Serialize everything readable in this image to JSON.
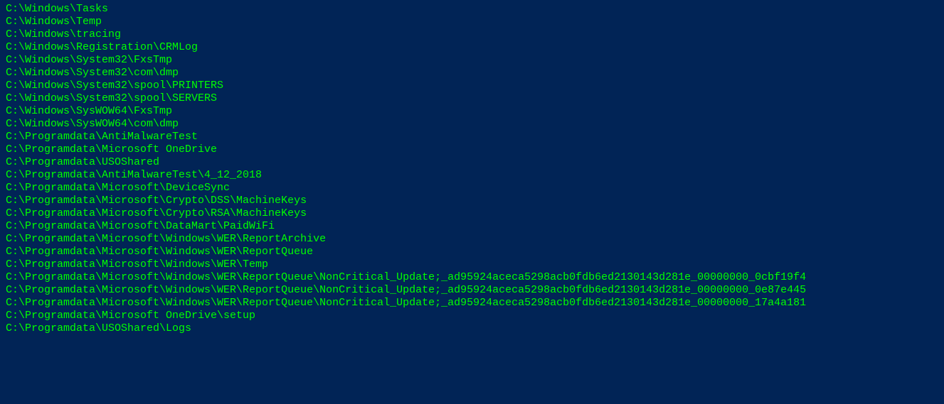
{
  "terminal": {
    "lines": [
      "C:\\Windows\\Tasks",
      "C:\\Windows\\Temp",
      "C:\\Windows\\tracing",
      "C:\\Windows\\Registration\\CRMLog",
      "C:\\Windows\\System32\\FxsTmp",
      "C:\\Windows\\System32\\com\\dmp",
      "C:\\Windows\\System32\\spool\\PRINTERS",
      "C:\\Windows\\System32\\spool\\SERVERS",
      "C:\\Windows\\SysWOW64\\FxsTmp",
      "C:\\Windows\\SysWOW64\\com\\dmp",
      "C:\\Programdata\\AntiMalwareTest",
      "C:\\Programdata\\Microsoft OneDrive",
      "C:\\Programdata\\USOShared",
      "C:\\Programdata\\AntiMalwareTest\\4_12_2018",
      "C:\\Programdata\\Microsoft\\DeviceSync",
      "C:\\Programdata\\Microsoft\\Crypto\\DSS\\MachineKeys",
      "C:\\Programdata\\Microsoft\\Crypto\\RSA\\MachineKeys",
      "C:\\Programdata\\Microsoft\\DataMart\\PaidWiFi",
      "C:\\Programdata\\Microsoft\\Windows\\WER\\ReportArchive",
      "C:\\Programdata\\Microsoft\\Windows\\WER\\ReportQueue",
      "C:\\Programdata\\Microsoft\\Windows\\WER\\Temp",
      "C:\\Programdata\\Microsoft\\Windows\\WER\\ReportQueue\\NonCritical_Update;_ad95924aceca5298acb0fdb6ed2130143d281e_00000000_0cbf19f4",
      "C:\\Programdata\\Microsoft\\Windows\\WER\\ReportQueue\\NonCritical_Update;_ad95924aceca5298acb0fdb6ed2130143d281e_00000000_0e87e445",
      "C:\\Programdata\\Microsoft\\Windows\\WER\\ReportQueue\\NonCritical_Update;_ad95924aceca5298acb0fdb6ed2130143d281e_00000000_17a4a181",
      "C:\\Programdata\\Microsoft OneDrive\\setup",
      "C:\\Programdata\\USOShared\\Logs"
    ]
  }
}
